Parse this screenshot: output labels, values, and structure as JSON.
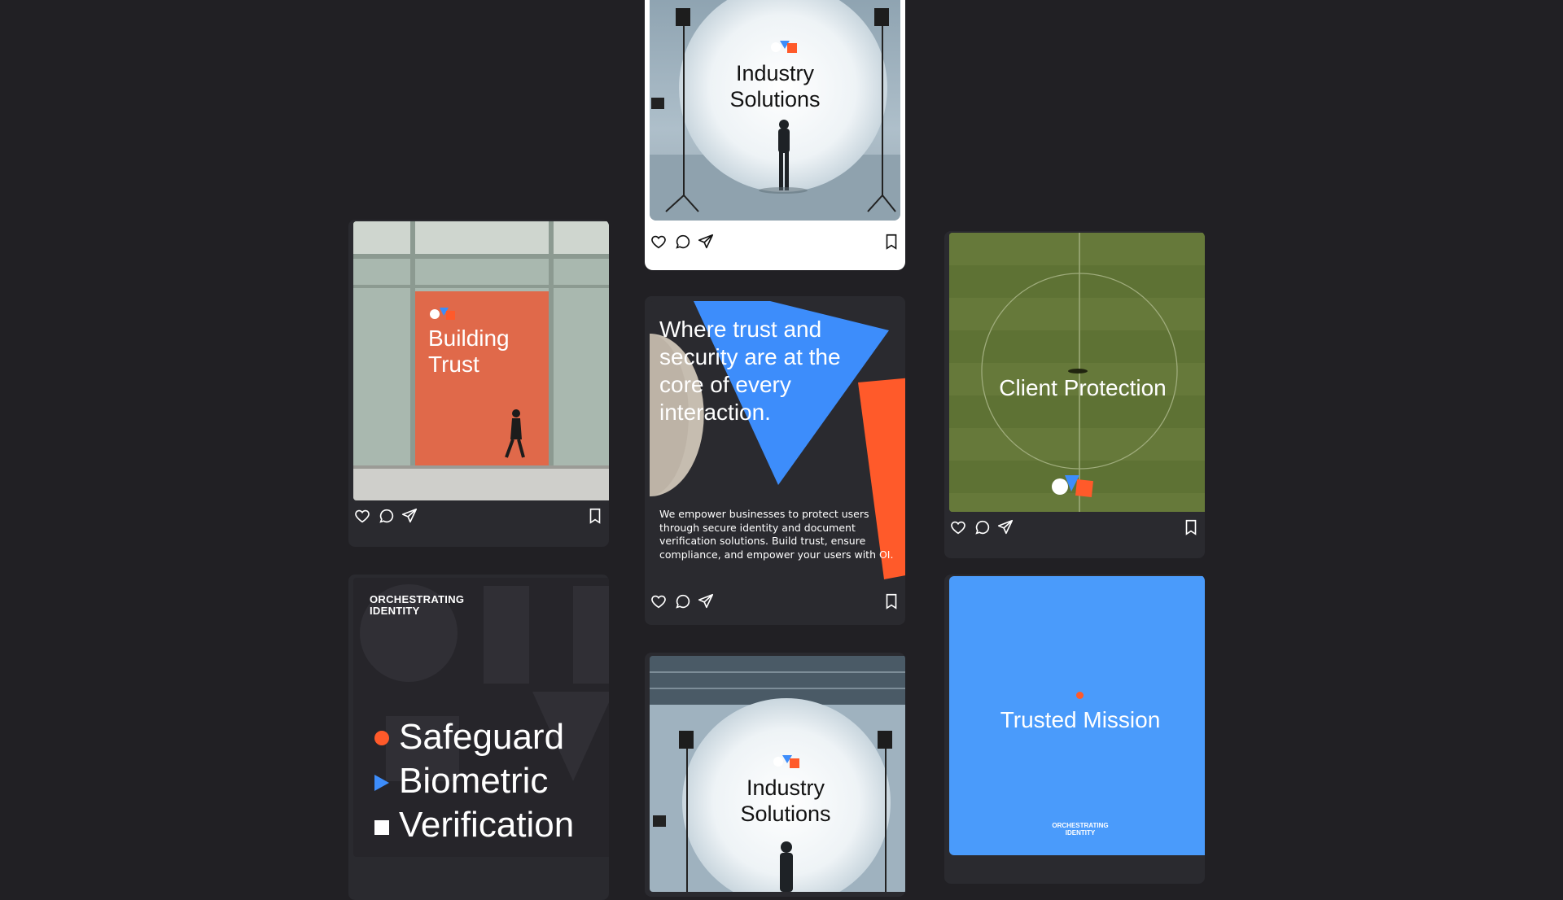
{
  "posts": {
    "industry_top": {
      "title_line1": "Industry",
      "title_line2": "Solutions"
    },
    "building_trust": {
      "title_line1": "Building",
      "title_line2": "Trust"
    },
    "quote": {
      "headline_lines": [
        "Where trust and",
        "security are at the",
        "core of every",
        "interaction."
      ],
      "body_lines": [
        "We empower businesses to protect users",
        "through secure identity and document",
        "verification solutions. Build trust, ensure",
        "compliance, and empower your users with OI."
      ]
    },
    "client_protection": {
      "title": "Client Protection"
    },
    "orchestrating": {
      "brand_line1": "ORCHESTRATING",
      "brand_line2": "IDENTITY",
      "items": [
        "Safeguard",
        "Biometric",
        "Verification"
      ]
    },
    "industry_bottom": {
      "title_line1": "Industry",
      "title_line2": "Solutions"
    },
    "trusted_mission": {
      "title": "Trusted Mission",
      "brand_line1": "ORCHESTRATING",
      "brand_line2": "IDENTITY"
    }
  },
  "colors": {
    "background": "#212024",
    "card": "#2a2a2f",
    "orange": "#ff5a2a",
    "blue": "#3d8dfb",
    "trusted_blue": "#4a9bfb"
  },
  "icons": [
    "heart-icon",
    "comment-icon",
    "share-icon",
    "bookmark-icon"
  ]
}
